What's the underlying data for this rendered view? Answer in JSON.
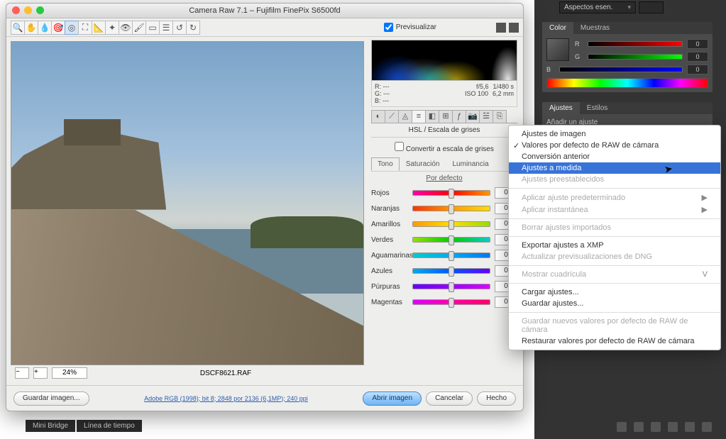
{
  "window": {
    "title": "Camera Raw 7.1 – Fujifilm FinePix S6500fd"
  },
  "toolbar": {
    "preview_label": "Previsualizar"
  },
  "meta": {
    "r": "R:   ---",
    "g": "G:   ---",
    "b": "B:   ---",
    "aperture": "f/5,6",
    "shutter": "1/480 s",
    "iso": "ISO 100",
    "focal": "6,2 mm"
  },
  "status": {
    "zoom": "24%",
    "filename": "DSCF8621.RAF"
  },
  "panel": {
    "title": "HSL / Escala de grises",
    "convert_label": "Convertir a escala de grises",
    "subtabs": {
      "tono": "Tono",
      "sat": "Saturación",
      "lum": "Luminancia"
    },
    "default": "Por defecto"
  },
  "sliders": [
    {
      "label": "Rojos",
      "val": "0",
      "grad": "g-red"
    },
    {
      "label": "Naranjas",
      "val": "0",
      "grad": "g-ora"
    },
    {
      "label": "Amarillos",
      "val": "0",
      "grad": "g-yel"
    },
    {
      "label": "Verdes",
      "val": "0",
      "grad": "g-grn"
    },
    {
      "label": "Aguamarinas",
      "val": "0",
      "grad": "g-aqu"
    },
    {
      "label": "Azules",
      "val": "0",
      "grad": "g-blu"
    },
    {
      "label": "Púrpuras",
      "val": "0",
      "grad": "g-pur"
    },
    {
      "label": "Magentas",
      "val": "0",
      "grad": "g-mag"
    }
  ],
  "footer": {
    "save": "Guardar imagen...",
    "link": "Adobe RGB (1998); bit 8; 2848 por 2136 (6,1MP); 240 ppi",
    "open": "Abrir imagen",
    "cancel": "Cancelar",
    "done": "Hecho"
  },
  "ps": {
    "panel_selector": "Aspectos esen.",
    "color_tab": "Color",
    "muestras_tab": "Muestras",
    "r": "R",
    "g": "G",
    "b": "B",
    "zero": "0",
    "ajustes_tab": "Ajustes",
    "estilos_tab": "Estilos",
    "anadir": "Añadir un ajuste",
    "bottom_mini": "Mini Bridge",
    "bottom_linea": "Línea de tiempo"
  },
  "ctx": {
    "i1": "Ajustes de imagen",
    "i2": "Valores por defecto de RAW de cámara",
    "i3": "Conversión anterior",
    "i4": "Ajustes a medida",
    "i5": "Ajustes preestablecidos",
    "i6": "Aplicar ajuste predeterminado",
    "i7": "Aplicar instantánea",
    "i8": "Borrar ajustes importados",
    "i9": "Exportar ajustes a XMP",
    "i10": "Actualizar previsualizaciones de DNG",
    "i11": "Mostrar cuadrícula",
    "i11s": "V",
    "i12": "Cargar ajustes...",
    "i13": "Guardar ajustes...",
    "i14": "Guardar nuevos valores por defecto de RAW de cámara",
    "i15": "Restaurar valores por defecto de RAW de cámara"
  }
}
